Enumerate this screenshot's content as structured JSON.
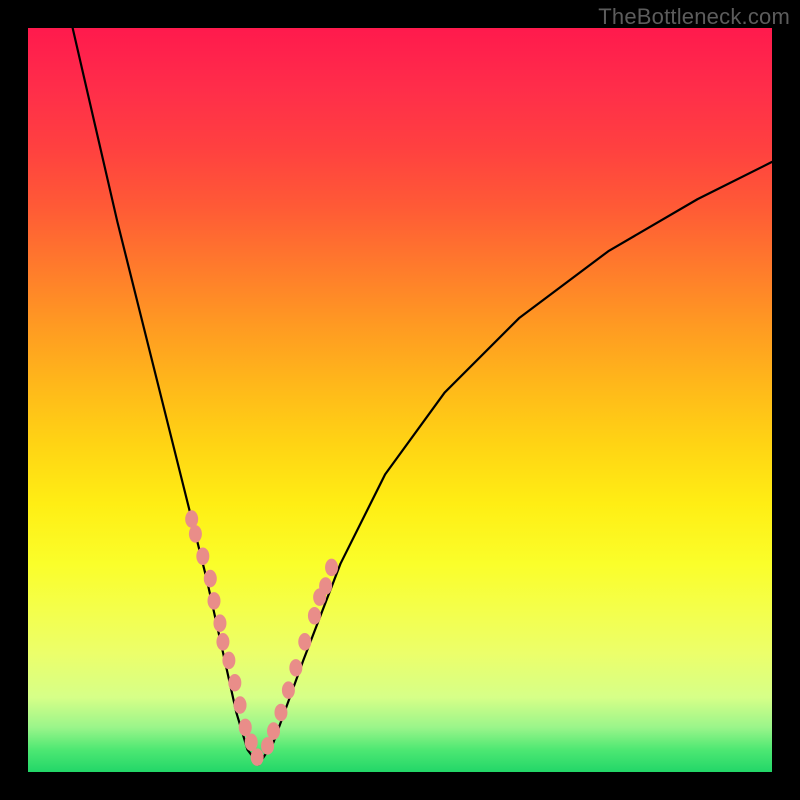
{
  "watermark": "TheBottleneck.com",
  "chart_data": {
    "type": "line",
    "title": "",
    "xlabel": "",
    "ylabel": "",
    "xlim": [
      0,
      1
    ],
    "ylim": [
      0,
      1
    ],
    "series": [
      {
        "name": "curve",
        "x": [
          0.06,
          0.09,
          0.12,
          0.15,
          0.18,
          0.21,
          0.24,
          0.26,
          0.28,
          0.295,
          0.31,
          0.33,
          0.37,
          0.42,
          0.48,
          0.56,
          0.66,
          0.78,
          0.9,
          1.0
        ],
        "y": [
          1.0,
          0.87,
          0.74,
          0.62,
          0.5,
          0.38,
          0.26,
          0.17,
          0.08,
          0.03,
          0.01,
          0.04,
          0.15,
          0.28,
          0.4,
          0.51,
          0.61,
          0.7,
          0.77,
          0.82
        ]
      },
      {
        "name": "left-cluster",
        "type": "scatter",
        "x": [
          0.22,
          0.225,
          0.235,
          0.245,
          0.25,
          0.258,
          0.262,
          0.27,
          0.278,
          0.285,
          0.292,
          0.3,
          0.308
        ],
        "y": [
          0.34,
          0.32,
          0.29,
          0.26,
          0.23,
          0.2,
          0.175,
          0.15,
          0.12,
          0.09,
          0.06,
          0.04,
          0.02
        ]
      },
      {
        "name": "right-cluster",
        "type": "scatter",
        "x": [
          0.322,
          0.33,
          0.34,
          0.35,
          0.36,
          0.372,
          0.385,
          0.4,
          0.392,
          0.408
        ],
        "y": [
          0.035,
          0.055,
          0.08,
          0.11,
          0.14,
          0.175,
          0.21,
          0.25,
          0.235,
          0.275
        ]
      }
    ],
    "colors": {
      "curve": "#000000",
      "scatter": "#e98d89"
    }
  }
}
